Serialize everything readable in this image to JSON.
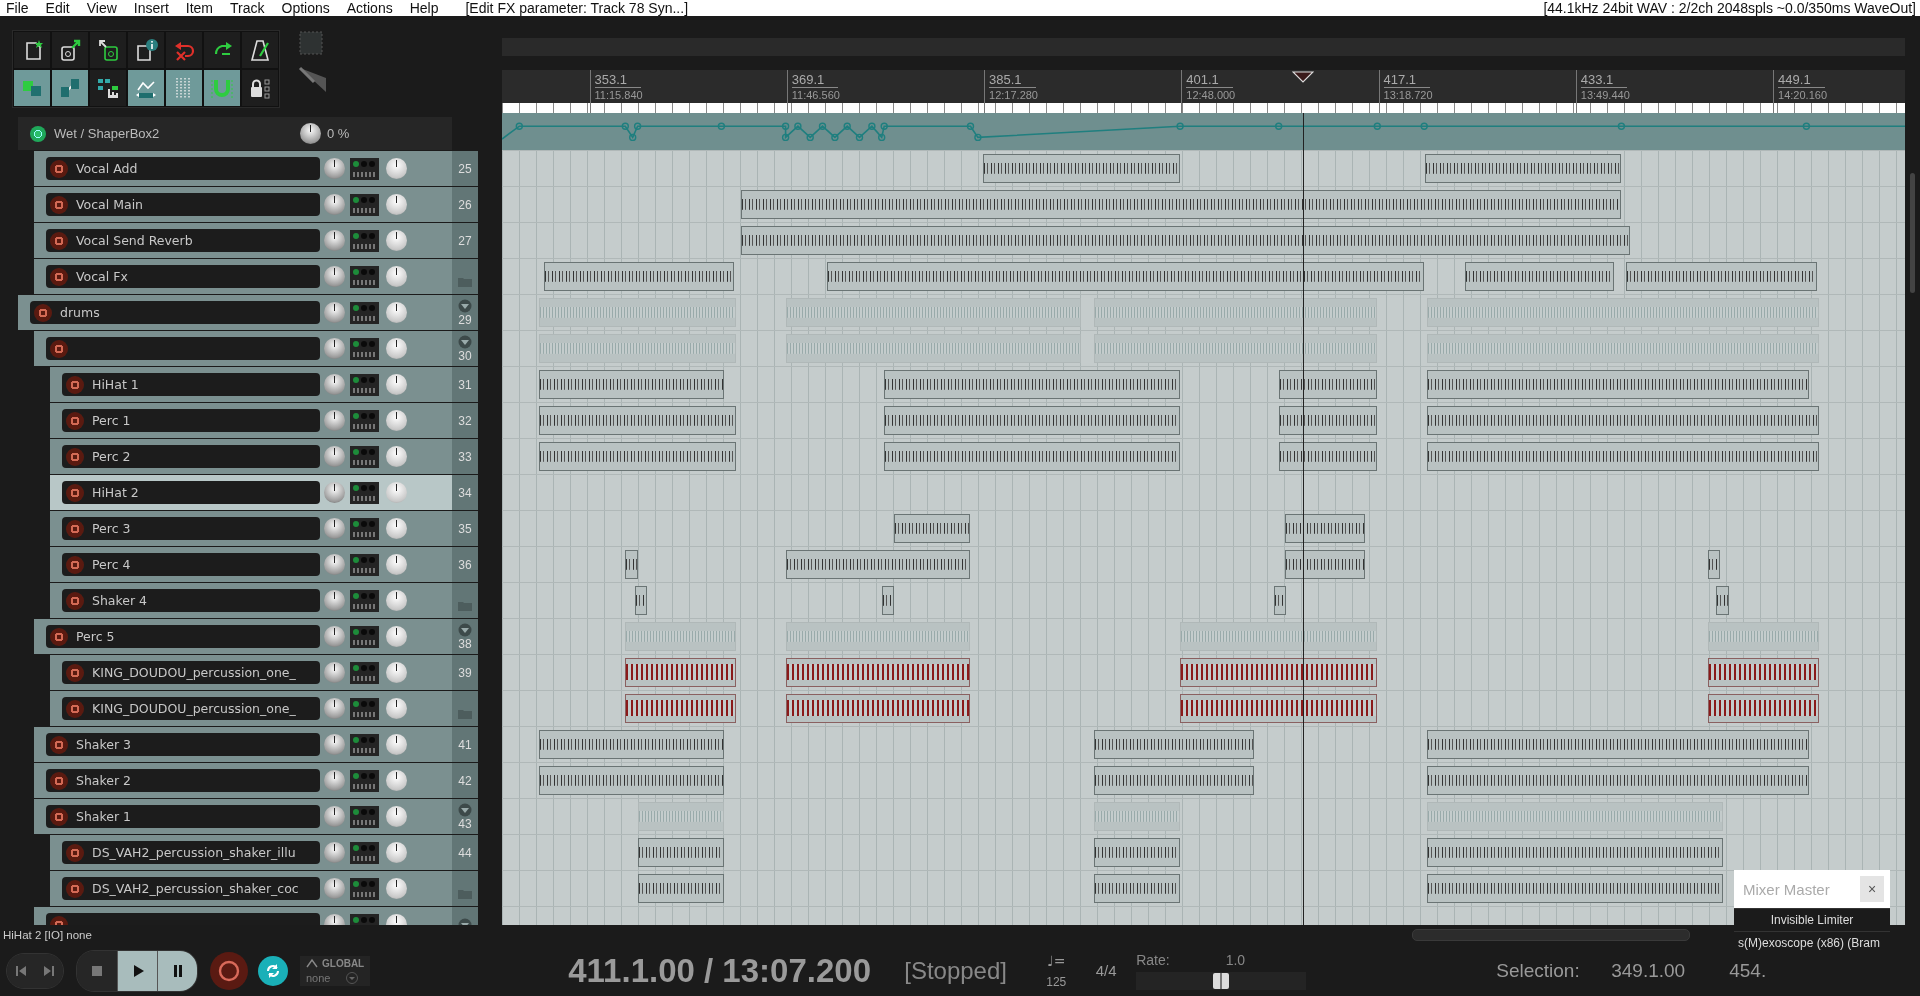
{
  "menu_bar": {
    "items": [
      "File",
      "Edit",
      "View",
      "Insert",
      "Item",
      "Track",
      "Options",
      "Actions",
      "Help"
    ],
    "title": "[Edit FX parameter: Track 78 Syn...]",
    "audio_status": "[44.1kHz 24bit WAV : 2/2ch 2048spls ~0.0/350ms WaveOut]"
  },
  "toolbar": {
    "buttons": [
      {
        "on": false
      },
      {
        "on": false
      },
      {
        "on": false
      },
      {
        "on": false
      },
      {
        "on": false
      },
      {
        "on": false
      },
      {
        "on": false
      },
      {
        "on": true
      },
      {
        "on": true
      },
      {
        "on": false
      },
      {
        "on": true
      },
      {
        "on": true
      },
      {
        "on": true
      },
      {
        "on": false
      }
    ]
  },
  "ruler": {
    "markers": [
      {
        "bar": "353.1",
        "time": "11:15.840"
      },
      {
        "bar": "369.1",
        "time": "11:46.560"
      },
      {
        "bar": "385.1",
        "time": "12:17.280"
      },
      {
        "bar": "401.1",
        "time": "12:48.000"
      },
      {
        "bar": "417.1",
        "time": "13:18.720"
      },
      {
        "bar": "433.1",
        "time": "13:49.440"
      },
      {
        "bar": "449.1",
        "time": "14:20.160"
      }
    ]
  },
  "tracks": [
    {
      "kind": "envelope",
      "name": "Wet / ShaperBox2",
      "reading": "0 %",
      "children": [
        {
          "kind": "track",
          "name": "Vocal Add",
          "number": "25",
          "selected": false
        },
        {
          "kind": "track",
          "name": "Vocal Main",
          "number": "26",
          "selected": false
        },
        {
          "kind": "track",
          "name": "Vocal Send Reverb",
          "number": "27",
          "selected": false
        },
        {
          "kind": "folder-end",
          "name": "Vocal Fx",
          "selected": false
        }
      ]
    },
    {
      "kind": "folder",
      "name": "drums",
      "number": "29",
      "selected": false,
      "children": [
        {
          "kind": "folder",
          "number": "30",
          "selected": false,
          "children": [
            {
              "kind": "track",
              "name": "HiHat 1",
              "number": "31",
              "selected": false
            },
            {
              "kind": "track",
              "name": "Perc 1",
              "number": "32",
              "selected": false
            },
            {
              "kind": "track",
              "name": "Perc 2",
              "number": "33",
              "selected": false
            },
            {
              "kind": "track",
              "name": "HiHat 2",
              "number": "34",
              "selected": true
            },
            {
              "kind": "track",
              "name": "Perc 3",
              "number": "35",
              "selected": false
            },
            {
              "kind": "track",
              "name": "Perc 4",
              "number": "36",
              "selected": false
            },
            {
              "kind": "folder-end",
              "name": "Shaker 4",
              "selected": false
            }
          ]
        },
        {
          "kind": "folder",
          "name": "Perc 5",
          "number": "38",
          "selected": false,
          "children": [
            {
              "kind": "track",
              "name": "KING_DOUDOU_percussion_one_",
              "number": "39",
              "selected": false
            },
            {
              "kind": "folder-end",
              "name": "KING_DOUDOU_percussion_one_",
              "selected": false
            }
          ]
        },
        {
          "kind": "track",
          "name": "Shaker 3",
          "number": "41",
          "selected": false
        },
        {
          "kind": "track",
          "name": "Shaker 2",
          "number": "42",
          "selected": false
        },
        {
          "kind": "folder",
          "name": "Shaker 1",
          "number": "43",
          "selected": false,
          "children": [
            {
              "kind": "track",
              "name": "DS_VAH2_percussion_shaker_illu",
              "number": "44",
              "selected": false
            },
            {
              "kind": "folder-end",
              "name": "DS_VAH2_percussion_shaker_coc",
              "selected": false
            }
          ]
        },
        {
          "kind": "folder",
          "selected": false
        }
      ]
    }
  ],
  "status_line": "HiHat 2 [IO] none",
  "transport": {
    "repeat": {
      "on": true
    },
    "automation_label": "GLOBAL",
    "automation_mode": "none",
    "position": "411.1.00 / 13:07.200",
    "state": "[Stopped]",
    "tempo_symbol": "♩=",
    "tempo": "125",
    "time_signature": "4/4",
    "rate_label": "Rate:",
    "rate": "1.0",
    "rate_slider": {
      "level": 0.5
    },
    "selection_label": "Selection:",
    "selection_start": "349.1.00",
    "selection_end": "454."
  },
  "fx_popup": {
    "title": "Mixer Master",
    "close": "×",
    "items": [
      "Invisible Limiter",
      "s(M)exoscope (x86) (Bram"
    ]
  }
}
